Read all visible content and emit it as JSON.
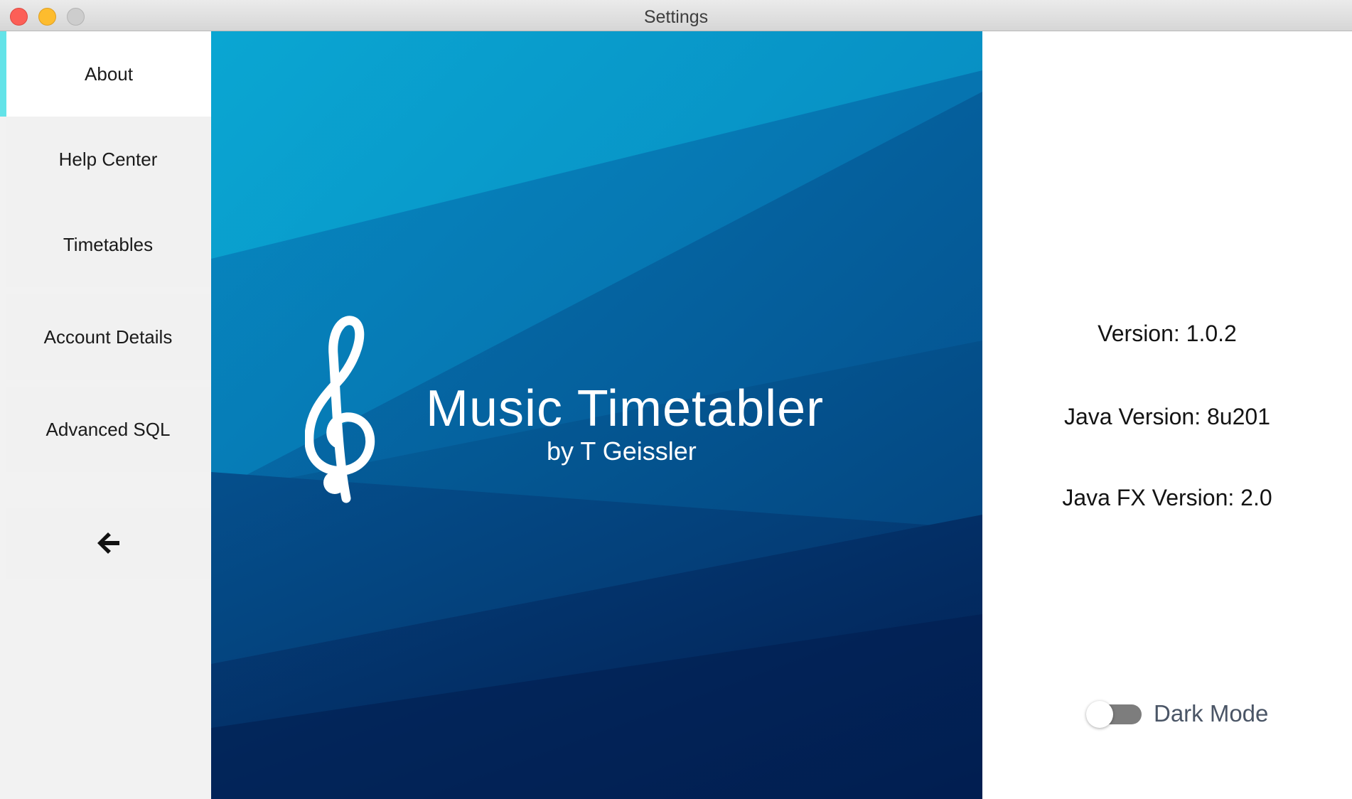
{
  "window": {
    "title": "Settings"
  },
  "sidebar": {
    "items": [
      {
        "label": "About",
        "active": true
      },
      {
        "label": "Help Center",
        "active": false
      },
      {
        "label": "Timetables",
        "active": false
      },
      {
        "label": "Account Details",
        "active": false
      },
      {
        "label": "Advanced SQL",
        "active": false
      }
    ],
    "back_icon": "arrow-left-icon"
  },
  "hero": {
    "app_name": "Music Timetabler",
    "author": "by T Geissler",
    "logo_icon": "treble-clef-icon"
  },
  "info": {
    "version": "Version: 1.0.2",
    "java_version": "Java Version: 8u201",
    "javafx_version": "Java FX Version: 2.0",
    "dark_mode_label": "Dark Mode",
    "dark_mode_on": false
  },
  "colors": {
    "accent": "#63e3e8",
    "hero_light": "#0aa3cf",
    "hero_dark": "#03265a",
    "toggle_track": "#7d7d7d"
  }
}
